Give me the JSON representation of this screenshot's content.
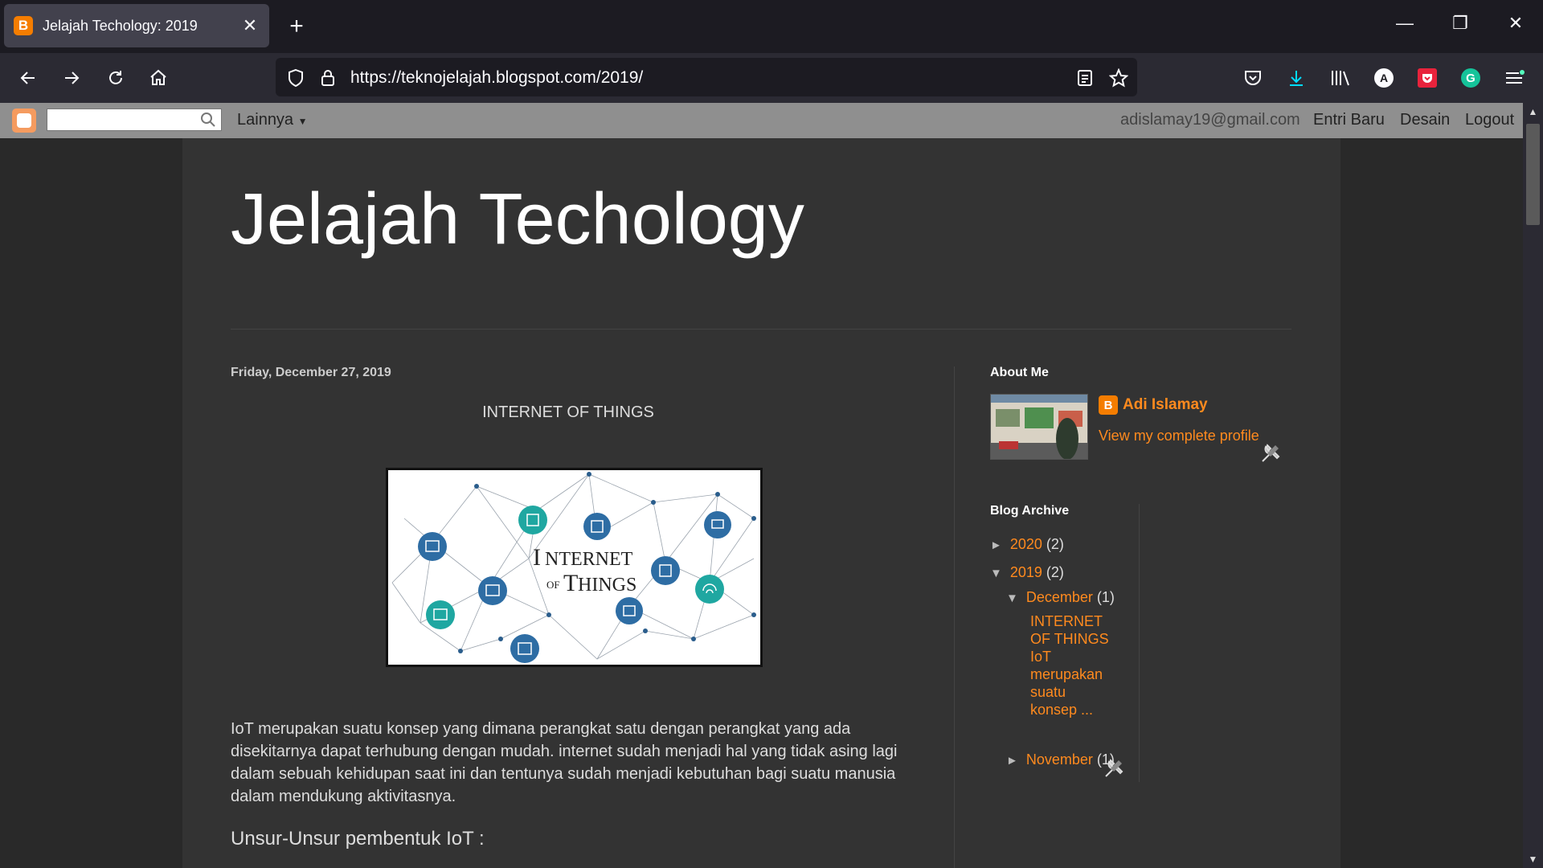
{
  "browser": {
    "tab_title": "Jelajah Techology: 2019",
    "tab_icon": "B",
    "url": "https://teknojelajah.blogspot.com/2019/"
  },
  "blogger_bar": {
    "search_value": "",
    "more_label": "Lainnya",
    "email": "adislamay19@gmail.com",
    "new_post": "Entri Baru",
    "design": "Desain",
    "logout": "Logout"
  },
  "blog": {
    "title": "Jelajah Techology",
    "post_date": "Friday, December 27, 2019",
    "post_title": "INTERNET OF THINGS",
    "image_text_line1": "NTERNET",
    "image_text_of": "OF",
    "image_text_line2": "HINGS",
    "paragraph": "IoT merupakan suatu konsep yang dimana perangkat satu dengan perangkat yang ada disekitarnya dapat terhubung dengan mudah. internet sudah menjadi hal yang tidak asing lagi dalam sebuah kehidupan saat ini dan tentunya sudah menjadi kebutuhan bagi suatu manusia dalam mendukung aktivitasnya.",
    "subheading": "Unsur-Unsur pembentuk IoT :"
  },
  "sidebar": {
    "about_heading": "About Me",
    "profile_name": "Adi Islamay",
    "view_profile": "View my complete profile",
    "archive_heading": "Blog Archive",
    "archive": [
      {
        "year": "2020",
        "count": "(2)",
        "expanded": false
      },
      {
        "year": "2019",
        "count": "(2)",
        "expanded": true
      }
    ],
    "months": [
      {
        "month": "December",
        "count": "(1)",
        "expanded": true
      },
      {
        "month": "November",
        "count": "(1)",
        "expanded": false
      }
    ],
    "post_link": "INTERNET OF THINGS IoT merupakan suatu konsep ..."
  },
  "colors": {
    "accent_orange": "#ff8a1e",
    "blogger_orange": "#f57d00",
    "page_bg": "#333333"
  }
}
